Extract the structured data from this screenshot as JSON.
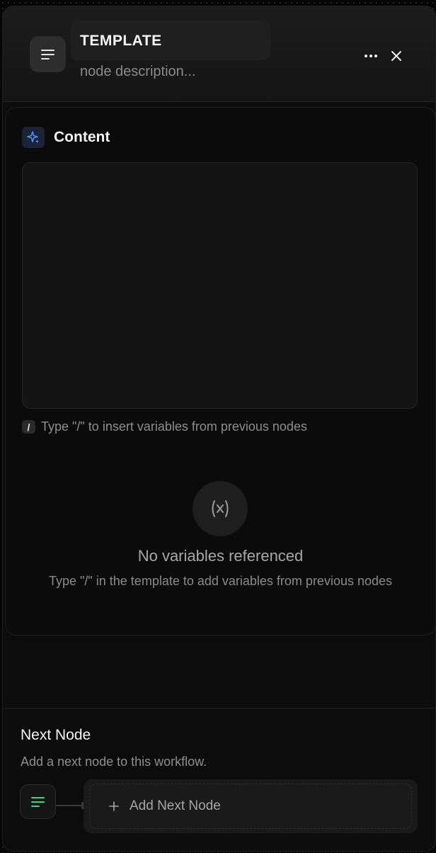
{
  "header": {
    "title": "TEMPLATE",
    "description_placeholder": "node description...",
    "icons": {
      "node": "text-lines-icon",
      "more": "more-horizontal-icon",
      "close": "close-icon"
    }
  },
  "content": {
    "title": "Content",
    "icon": "sparkles-icon",
    "editor_value": "",
    "slash_key": "/",
    "hint": "Type \"/\" to insert variables from previous nodes"
  },
  "variables": {
    "icon": "variable-x-icon",
    "empty_title": "No variables referenced",
    "empty_subtitle": "Type \"/\" in the template to add variables from previous nodes"
  },
  "next_node": {
    "title": "Next Node",
    "subtitle": "Add a next node to this workflow.",
    "add_label": "Add Next Node",
    "node_icon": "text-lines-icon",
    "add_icon": "plus-icon"
  },
  "colors": {
    "accent_blue": "#5b8def",
    "accent_green": "#3ecf8e",
    "background": "#0c0c0c"
  }
}
